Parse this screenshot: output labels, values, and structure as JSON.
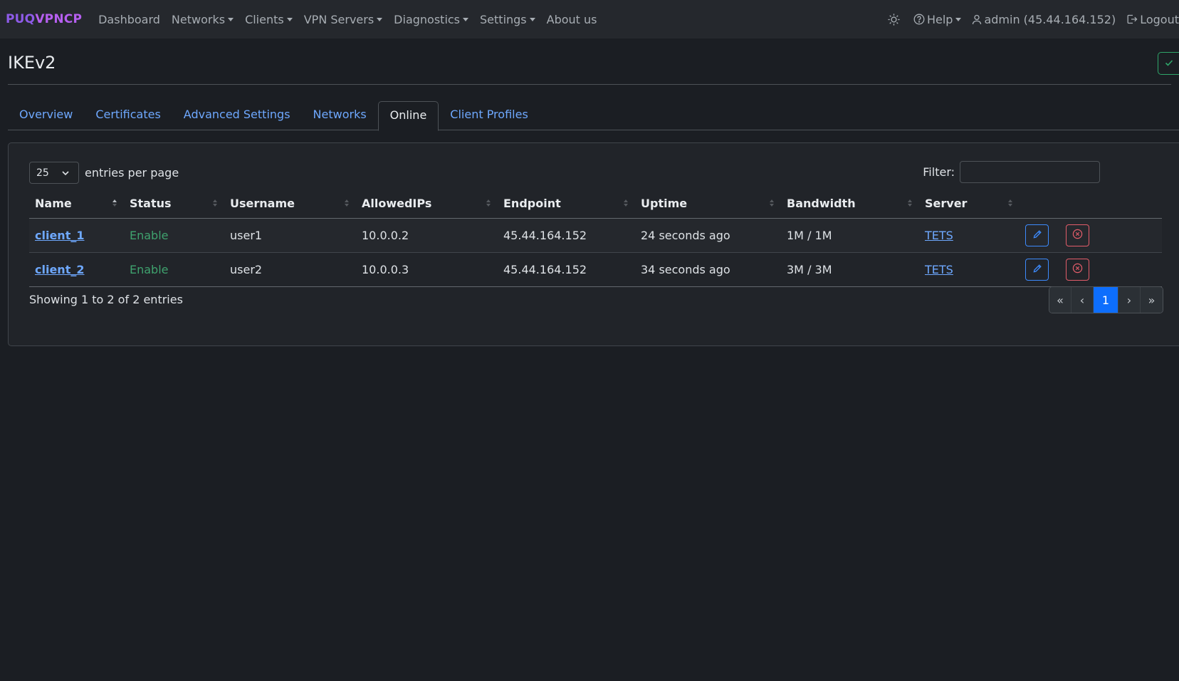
{
  "brand": {
    "part1": "PUQ",
    "part2": "VPNCP"
  },
  "nav": {
    "items": [
      "Dashboard",
      "Networks",
      "Clients",
      "VPN Servers",
      "Diagnostics",
      "Settings",
      "About us"
    ],
    "help": "Help",
    "user": "admin (45.44.164.152)",
    "logout": "Logout"
  },
  "page": {
    "title": "IKEv2"
  },
  "tabs": [
    "Overview",
    "Certificates",
    "Advanced Settings",
    "Networks",
    "Online",
    "Client Profiles"
  ],
  "table_controls": {
    "per_page": "25",
    "per_page_label": "entries per page",
    "filter_label": "Filter:",
    "filter_value": ""
  },
  "table": {
    "headers": [
      "Name",
      "Status",
      "Username",
      "AllowedIPs",
      "Endpoint",
      "Uptime",
      "Bandwidth",
      "Server"
    ],
    "rows": [
      {
        "name": "client_1",
        "status": "Enable",
        "username": "user1",
        "allowed_ips": "10.0.0.2",
        "endpoint": "45.44.164.152",
        "uptime": "24 seconds ago",
        "bandwidth": "1M / 1M",
        "server": "TETS"
      },
      {
        "name": "client_2",
        "status": "Enable",
        "username": "user2",
        "allowed_ips": "10.0.0.3",
        "endpoint": "45.44.164.152",
        "uptime": "34 seconds ago",
        "bandwidth": "3M / 3M",
        "server": "TETS"
      }
    ]
  },
  "footer": {
    "info": "Showing 1 to 2 of 2 entries",
    "pager": {
      "first": "«",
      "prev": "‹",
      "current": "1",
      "next": "›",
      "last": "»"
    }
  },
  "colors": {
    "accent": "#0d6efd",
    "link": "#6ea8fe",
    "success": "#3fa26e",
    "danger": "#e35d6a",
    "brand": "#8e5be8"
  }
}
